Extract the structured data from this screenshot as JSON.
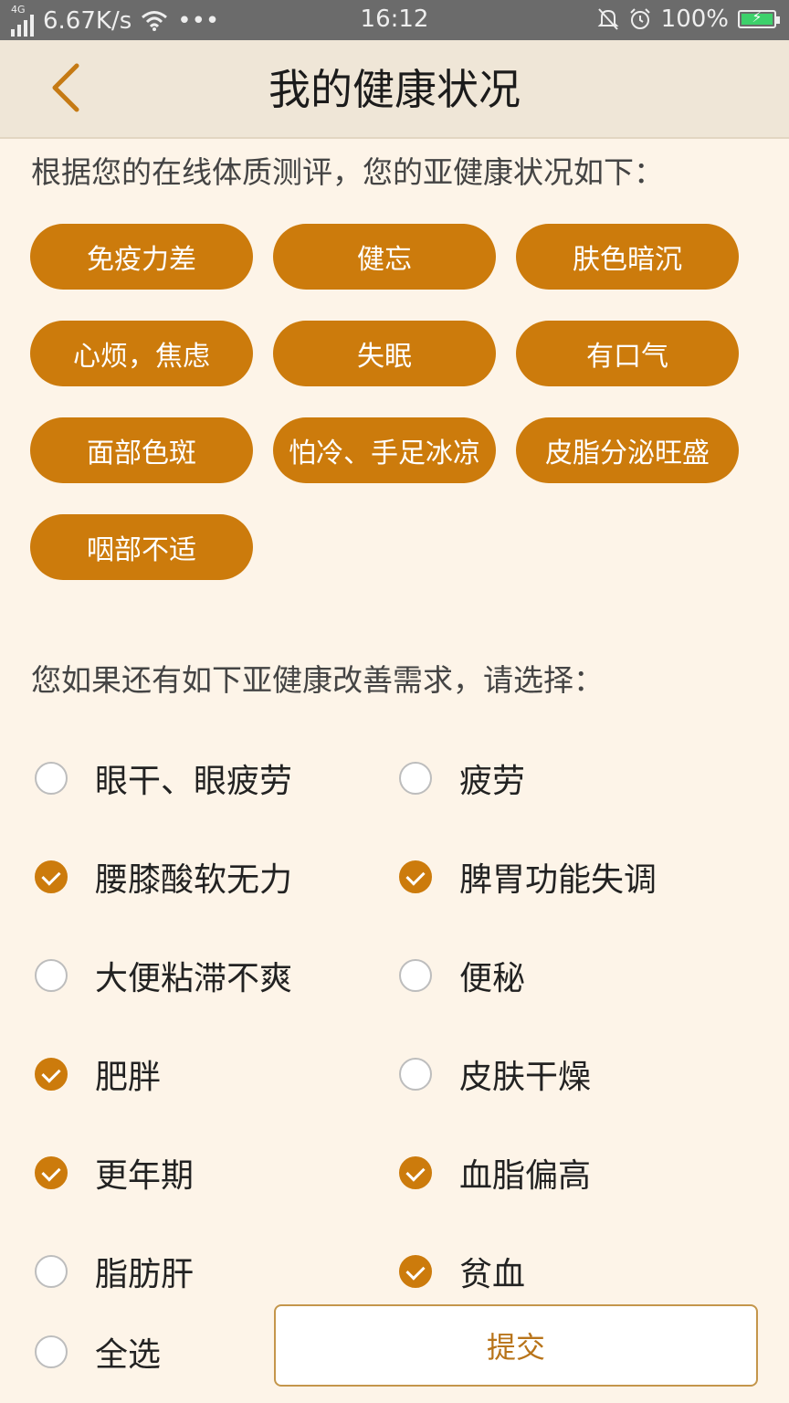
{
  "status_bar": {
    "network": "4G",
    "speed": "6.67K/s",
    "more": "•••",
    "time": "16:12",
    "battery": "100%"
  },
  "header": {
    "title": "我的健康状况"
  },
  "intro_text": "根据您的在线体质测评，您的亚健康状况如下：",
  "tags": [
    "免疫力差",
    "健忘",
    "肤色暗沉",
    "心烦，焦虑",
    "失眠",
    "有口气",
    "面部色斑",
    "怕冷、手足冰凉",
    "皮脂分泌旺盛",
    "咽部不适"
  ],
  "prompt_text": "您如果还有如下亚健康改善需求，请选择：",
  "options": [
    {
      "label": "眼干、眼疲劳",
      "checked": false
    },
    {
      "label": "疲劳",
      "checked": false
    },
    {
      "label": "腰膝酸软无力",
      "checked": true
    },
    {
      "label": "脾胃功能失调",
      "checked": true
    },
    {
      "label": "大便粘滞不爽",
      "checked": false
    },
    {
      "label": "便秘",
      "checked": false
    },
    {
      "label": "肥胖",
      "checked": true
    },
    {
      "label": "皮肤干燥",
      "checked": false
    },
    {
      "label": "更年期",
      "checked": true
    },
    {
      "label": "血脂偏高",
      "checked": true
    },
    {
      "label": "脂肪肝",
      "checked": false
    },
    {
      "label": "贫血",
      "checked": true
    }
  ],
  "select_all": {
    "label": "全选",
    "checked": false
  },
  "submit_label": "提交",
  "colors": {
    "accent": "#cc7b0c",
    "background": "#fdf4e8"
  }
}
